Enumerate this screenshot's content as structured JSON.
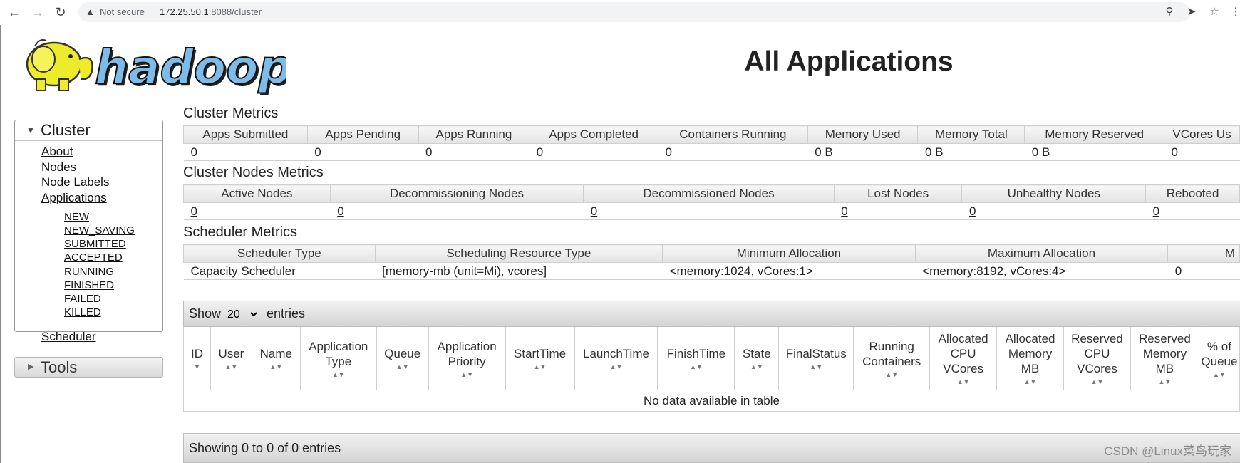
{
  "browser": {
    "warning_label": "Not secure",
    "url_host": "172.25.50.1",
    "url_rest": ":8088/cluster"
  },
  "header": {
    "title": "All Applications",
    "logo_text": "hadoop"
  },
  "sidebar": {
    "cluster_label": "Cluster",
    "links": [
      "About",
      "Nodes",
      "Node Labels",
      "Applications"
    ],
    "app_states": [
      "NEW",
      "NEW_SAVING",
      "SUBMITTED",
      "ACCEPTED",
      "RUNNING",
      "FINISHED",
      "FAILED",
      "KILLED"
    ],
    "scheduler_label": "Scheduler",
    "tools_label": "Tools"
  },
  "cluster_metrics": {
    "title": "Cluster Metrics",
    "headers": [
      "Apps Submitted",
      "Apps Pending",
      "Apps Running",
      "Apps Completed",
      "Containers Running",
      "Memory Used",
      "Memory Total",
      "Memory Reserved",
      "VCores Us"
    ],
    "values": [
      "0",
      "0",
      "0",
      "0",
      "0",
      "0 B",
      "0 B",
      "0 B",
      "0"
    ]
  },
  "nodes_metrics": {
    "title": "Cluster Nodes Metrics",
    "headers": [
      "Active Nodes",
      "Decommissioning Nodes",
      "Decommissioned Nodes",
      "Lost Nodes",
      "Unhealthy Nodes",
      "Rebooted"
    ],
    "values": [
      "0",
      "0",
      "0",
      "0",
      "0",
      "0"
    ]
  },
  "scheduler_metrics": {
    "title": "Scheduler Metrics",
    "headers": [
      "Scheduler Type",
      "Scheduling Resource Type",
      "Minimum Allocation",
      "Maximum Allocation",
      "M"
    ],
    "values": [
      "Capacity Scheduler",
      "[memory-mb (unit=Mi), vcores]",
      "<memory:1024, vCores:1>",
      "<memory:8192, vCores:4>",
      "0"
    ]
  },
  "apps_table": {
    "show_label": "Show",
    "page_size": "20",
    "page_size_options": [
      "20"
    ],
    "entries_label": "entries",
    "columns": [
      "ID",
      "User",
      "Name",
      "Application Type",
      "Queue",
      "Application Priority",
      "StartTime",
      "LaunchTime",
      "FinishTime",
      "State",
      "FinalStatus",
      "Running Containers",
      "Allocated CPU VCores",
      "Allocated Memory MB",
      "Reserved CPU VCores",
      "Reserved Memory MB",
      "% of Queue"
    ],
    "empty_message": "No data available in table",
    "footer_info": "Showing 0 to 0 of 0 entries"
  },
  "watermark": "CSDN @Linux菜鸟玩家"
}
